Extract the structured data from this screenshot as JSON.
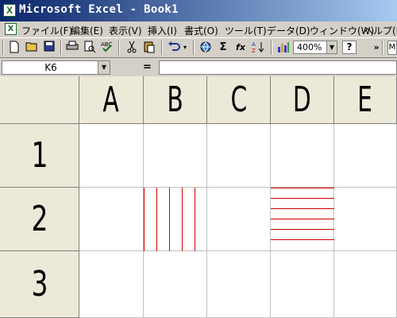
{
  "window": {
    "title": "Microsoft Excel - Book1",
    "app_icon": "X"
  },
  "menu": [
    "ファイル(F)",
    "編集(E)",
    "表示(V)",
    "挿入(I)",
    "書式(O)",
    "ツール(T)",
    "データ(D)",
    "ウィンドウ(W)",
    "ヘルプ(H"
  ],
  "toolbar": {
    "zoom": "400%",
    "help": "?",
    "sigma": "Σ",
    "fx": "fx",
    "overflow": "»",
    "truncated": "M"
  },
  "formula_bar": {
    "name_box": "K6",
    "equals": "=",
    "formula": ""
  },
  "sheet": {
    "columns": [
      "A",
      "B",
      "C",
      "D",
      "E"
    ],
    "rows": [
      "1",
      "2",
      "3"
    ],
    "line_color": "#cc0000",
    "b2_vertical_lines": 5,
    "d2_horizontal_lines": 6
  }
}
